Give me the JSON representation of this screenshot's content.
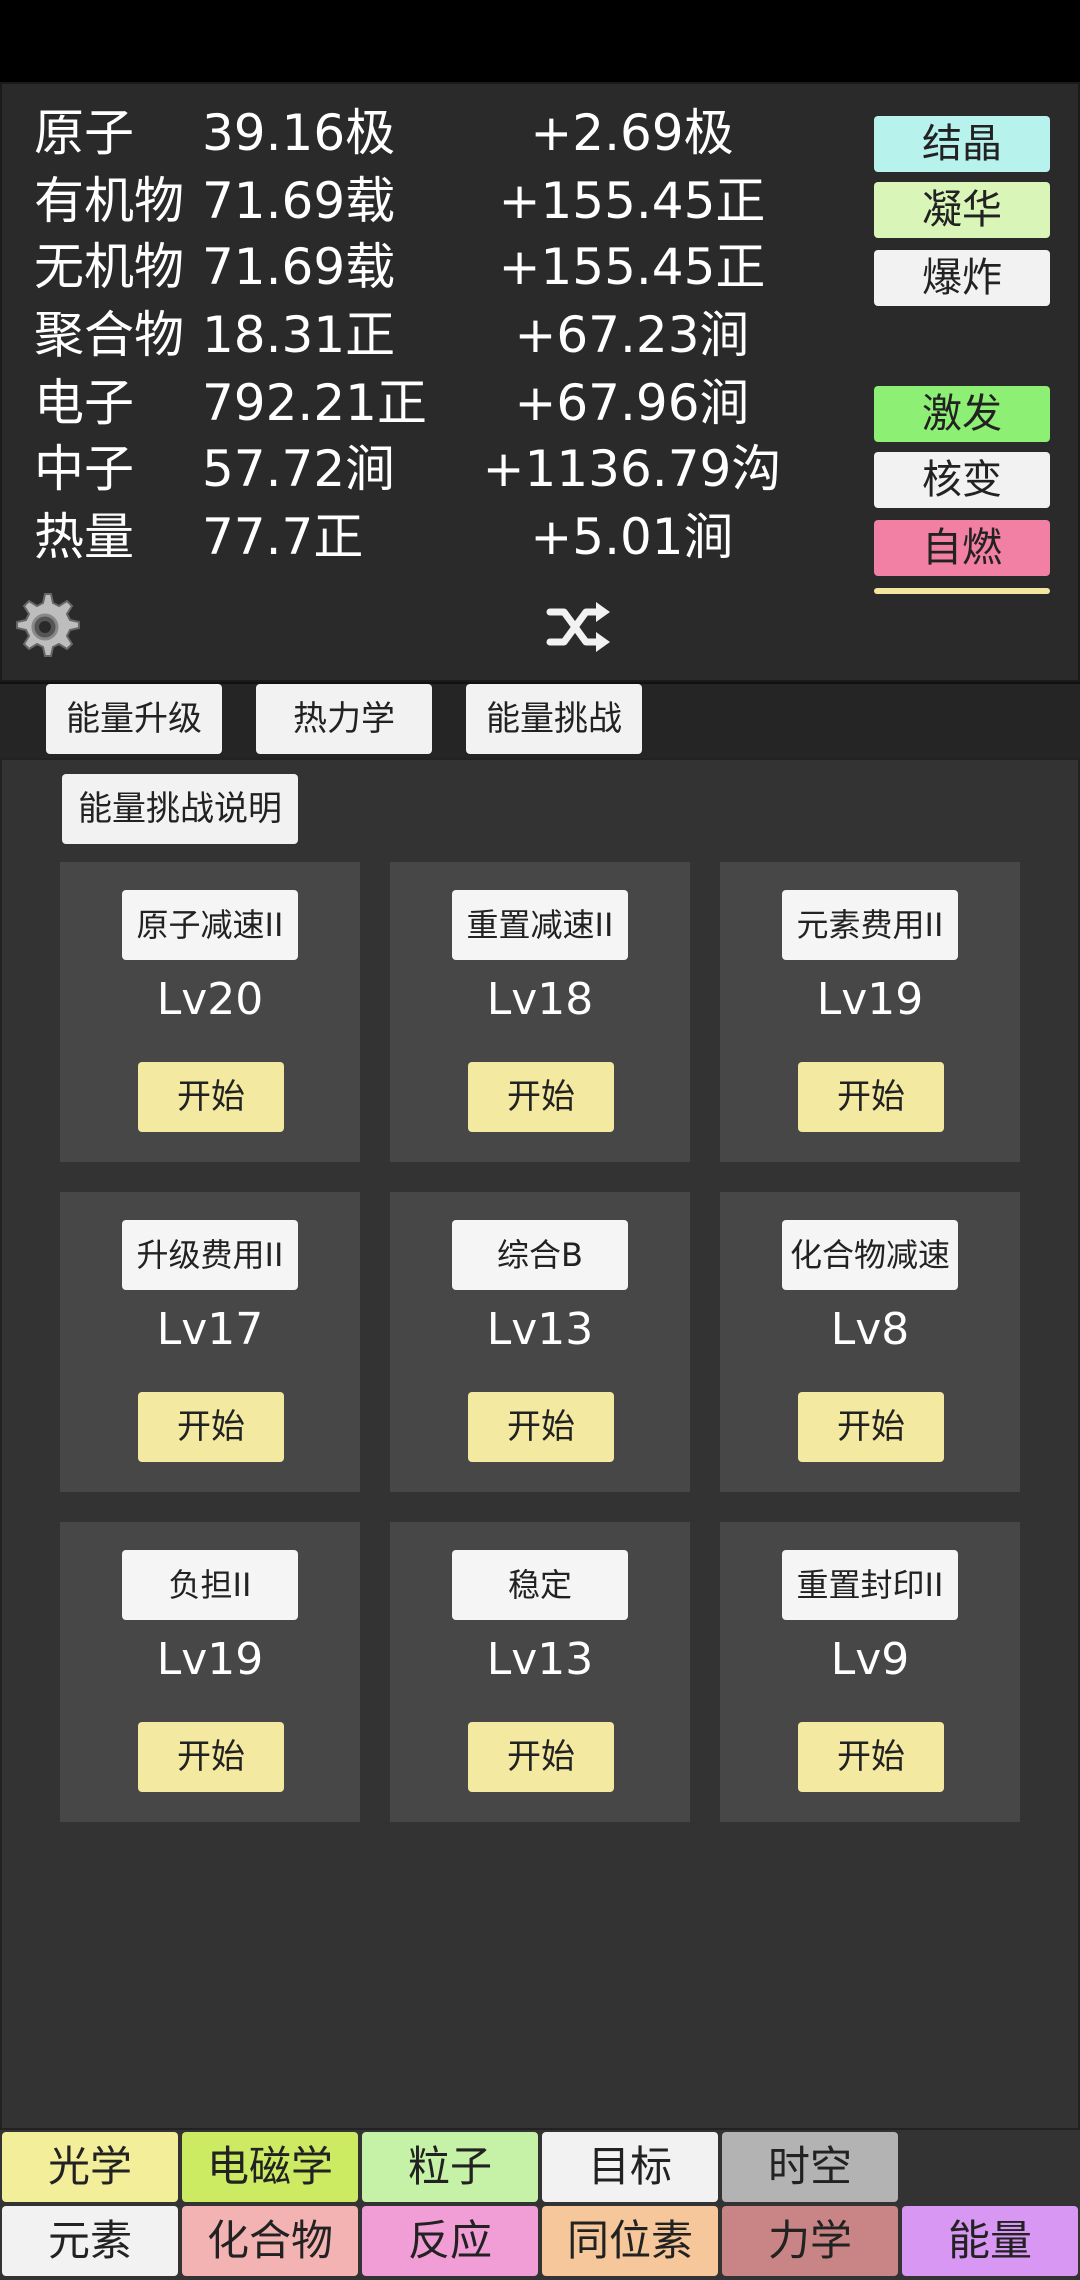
{
  "resources": [
    {
      "name": "原子",
      "amount": "39.16极",
      "rate": "+2.69极"
    },
    {
      "name": "有机物",
      "amount": "71.69载",
      "rate": "+155.45正"
    },
    {
      "name": "无机物",
      "amount": "71.69载",
      "rate": "+155.45正"
    },
    {
      "name": "聚合物",
      "amount": "18.31正",
      "rate": "+67.23涧"
    },
    {
      "name": "电子",
      "amount": "792.21正",
      "rate": "+67.96涧"
    },
    {
      "name": "中子",
      "amount": "57.72涧",
      "rate": "+1136.79沟"
    },
    {
      "name": "热量",
      "amount": "77.7正",
      "rate": "+5.01涧"
    }
  ],
  "actions": [
    {
      "label": "结晶",
      "color": "#b8f2ec"
    },
    {
      "label": "凝华",
      "color": "#d9f5b8"
    },
    {
      "label": "爆炸",
      "color": "#f2f2f2"
    },
    {
      "label": "激发",
      "color": "#8def74"
    },
    {
      "label": "核变",
      "color": "#f2f2f2"
    },
    {
      "label": "自燃",
      "color": "#f27fa4"
    },
    {
      "label": "",
      "color": "#f3e7a0"
    }
  ],
  "icons": {
    "settings": "gear-icon",
    "shuffle": "shuffle-icon"
  },
  "tabs": [
    "能量升级",
    "热力学",
    "能量挑战"
  ],
  "help_label": "能量挑战说明",
  "challenges": [
    {
      "title": "原子减速II",
      "level": "Lv20",
      "start": "开始"
    },
    {
      "title": "重置减速II",
      "level": "Lv18",
      "start": "开始"
    },
    {
      "title": "元素费用II",
      "level": "Lv19",
      "start": "开始"
    },
    {
      "title": "升级费用II",
      "level": "Lv17",
      "start": "开始"
    },
    {
      "title": "综合B",
      "level": "Lv13",
      "start": "开始"
    },
    {
      "title": "化合物减速",
      "level": "Lv8",
      "start": "开始"
    },
    {
      "title": "负担II",
      "level": "Lv19",
      "start": "开始"
    },
    {
      "title": "稳定",
      "level": "Lv13",
      "start": "开始"
    },
    {
      "title": "重置封印II",
      "level": "Lv9",
      "start": "开始"
    }
  ],
  "nav_top": [
    {
      "label": "光学",
      "color": "#f3ee9a"
    },
    {
      "label": "电磁学",
      "color": "#cdea63"
    },
    {
      "label": "粒子",
      "color": "#c6f2a8"
    },
    {
      "label": "目标",
      "color": "#f2f2f2"
    },
    {
      "label": "时空",
      "color": "#b3b3b3"
    }
  ],
  "nav_bottom": [
    {
      "label": "元素",
      "color": "#f2f2f2"
    },
    {
      "label": "化合物",
      "color": "#f3b3b3"
    },
    {
      "label": "反应",
      "color": "#f29ed6"
    },
    {
      "label": "同位素",
      "color": "#f6c79a"
    },
    {
      "label": "力学",
      "color": "#c98585"
    },
    {
      "label": "能量",
      "color": "#d897f2"
    }
  ]
}
